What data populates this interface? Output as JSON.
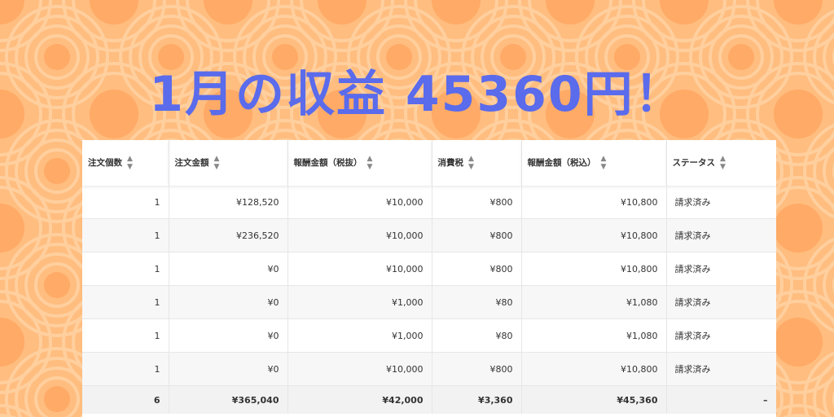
{
  "colors": {
    "background": "#ffbd7f",
    "title": "#5a6bec",
    "table_bg": "#ffffff",
    "row_alt": "#f7f7f7",
    "total_row": "#f2f2f2"
  },
  "title": "1月の収益 45360円！",
  "table": {
    "sort_icon": "sort-icon",
    "headers": [
      "注文個数",
      "注文金額",
      "報酬金額（税抜）",
      "消費税",
      "報酬金額（税込）",
      "ステータス"
    ],
    "rows": [
      [
        "1",
        "¥128,520",
        "¥10,000",
        "¥800",
        "¥10,800",
        "請求済み"
      ],
      [
        "1",
        "¥236,520",
        "¥10,000",
        "¥800",
        "¥10,800",
        "請求済み"
      ],
      [
        "1",
        "¥0",
        "¥10,000",
        "¥800",
        "¥10,800",
        "請求済み"
      ],
      [
        "1",
        "¥0",
        "¥1,000",
        "¥80",
        "¥1,080",
        "請求済み"
      ],
      [
        "1",
        "¥0",
        "¥1,000",
        "¥80",
        "¥1,080",
        "請求済み"
      ],
      [
        "1",
        "¥0",
        "¥10,000",
        "¥800",
        "¥10,800",
        "請求済み"
      ]
    ],
    "total": [
      "6",
      "¥365,040",
      "¥42,000",
      "¥3,360",
      "¥45,360",
      "–"
    ]
  }
}
